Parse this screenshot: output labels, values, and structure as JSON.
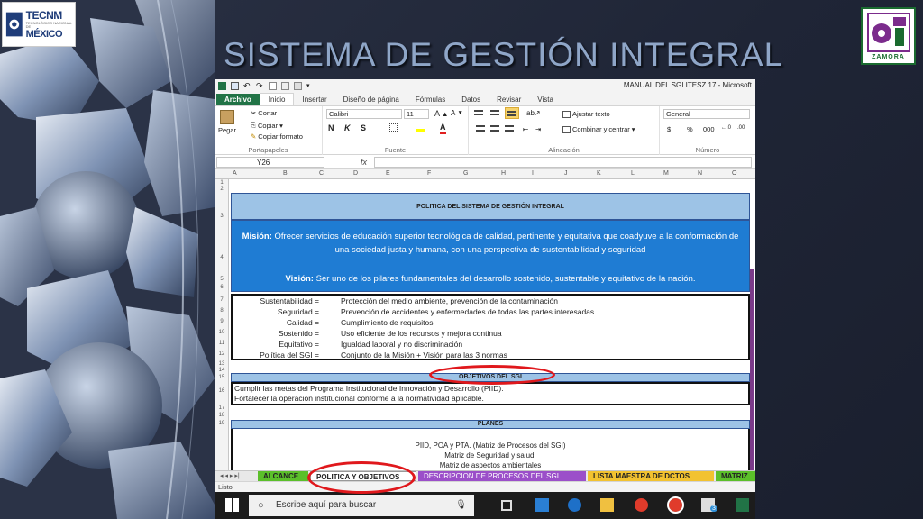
{
  "slide": {
    "title": "SISTEMA DE GESTIÓN INTEGRAL",
    "logo_left": {
      "line1": "TECNM",
      "line2": "TECNOLÓGICO NACIONAL DE",
      "line3": "MÉXICO"
    },
    "logo_right": {
      "text": "ZAMORA"
    }
  },
  "excel": {
    "window_title": "MANUAL DEL SGI ITESZ 17 - Microsoft",
    "tabs": [
      "Archivo",
      "Inicio",
      "Insertar",
      "Diseño de página",
      "Fórmulas",
      "Datos",
      "Revisar",
      "Vista"
    ],
    "active_tab": "Inicio",
    "ribbon": {
      "paste": "Pegar",
      "cut": "Cortar",
      "copy": "Copiar",
      "format_painter": "Copiar formato",
      "clipboard_group": "Portapapeles",
      "font_name": "Calibri",
      "font_size": "11",
      "bold": "N",
      "italic": "K",
      "underline": "S",
      "font_group": "Fuente",
      "wrap_text": "Ajustar texto",
      "merge_center": "Combinar y centrar",
      "alignment_group": "Alineación",
      "number_format": "General",
      "currency": "$",
      "percent": "%",
      "thousands": "000",
      "number_group": "Número"
    },
    "name_box": "Y26",
    "fx": "fx",
    "columns": [
      "A",
      "B",
      "C",
      "D",
      "E",
      "F",
      "G",
      "H",
      "I",
      "J",
      "K",
      "L",
      "M",
      "N",
      "O"
    ],
    "rows": [
      "1",
      "2",
      "3",
      "4",
      "5",
      "6",
      "7",
      "8",
      "9",
      "10",
      "11",
      "12",
      "13",
      "14",
      "15",
      "16",
      "17",
      "18",
      "19"
    ],
    "policy_header": "POLITICA DEL SISTEMA DE GESTIÓN INTEGRAL",
    "mision_label": "Misión:",
    "mision_text": "Ofrecer servicios de educación superior tecnológica de calidad, pertinente y equitativa que coadyuve a la conformación de una sociedad justa y humana, con una perspectiva de sustentabilidad y seguridad",
    "vision_label": "Visión:",
    "vision_text": "Ser uno de los pilares fundamentales del desarrollo sostenido, sustentable y equitativo de la nación.",
    "definitions": [
      {
        "k": "Sustentabilidad =",
        "v": "Protección del medio ambiente, prevención de la contaminación"
      },
      {
        "k": "Seguridad =",
        "v": "Prevención de accidentes y enfermedades de todas las partes interesadas"
      },
      {
        "k": "Calidad =",
        "v": "Cumplimiento de requisitos"
      },
      {
        "k": "Sostenido =",
        "v": "Uso eficiente de los recursos y mejora continua"
      },
      {
        "k": "Equitativo =",
        "v": "Igualdad laboral y no discriminación"
      },
      {
        "k": "Política del SGI =",
        "v": "Conjunto de la Misión + Visión para las 3 normas"
      }
    ],
    "objectives_header": "OBJETIVOS DEL SGI",
    "objectives": [
      "Cumplir las metas del Programa Institucional de Innovación y Desarrollo (PIID).",
      "Fortalecer la operación institucional conforme a la normatividad aplicable."
    ],
    "plans_header": "PLANES",
    "plans": [
      "PIID, POA y PTA. (Matriz de Procesos del SGI)",
      "Matriz de Seguridad y salud.",
      "Matriz de aspectos ambientales"
    ],
    "sheet_tabs": [
      {
        "label": "ALCANCE",
        "color": "#5bbf2a"
      },
      {
        "label": "POLITICA Y OBJETIVOS",
        "color": "#ffffff"
      },
      {
        "label": "DESCRIPCION DE PROCESOS DEL SGI",
        "color": "#9b4fc9"
      },
      {
        "label": "LISTA MAESTRA DE DCTOS",
        "color": "#f2c230"
      },
      {
        "label": "MATRIZ",
        "color": "#5bbf2a"
      }
    ],
    "status": "Listo",
    "taskbar_search": "Escribe aquí para buscar",
    "taskbar_badge": "3"
  }
}
